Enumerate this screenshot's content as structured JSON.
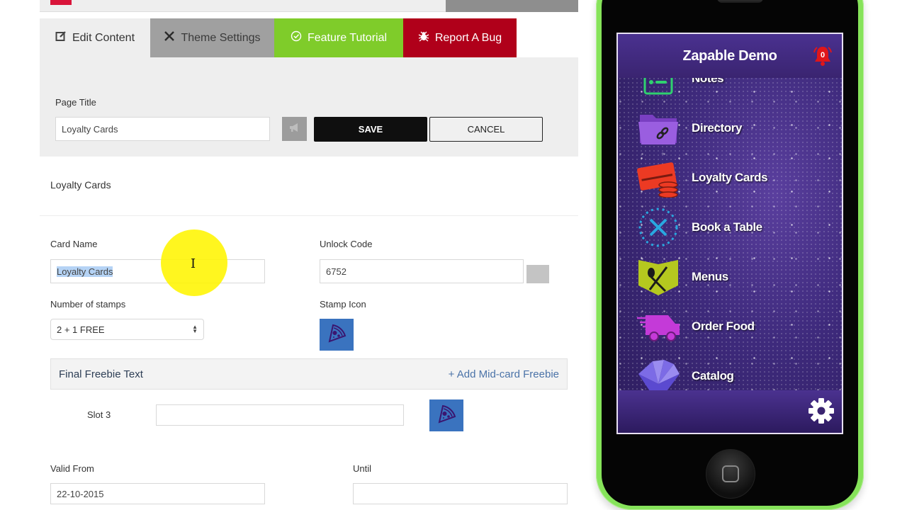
{
  "tabs": [
    {
      "label": "Edit Content",
      "icon": "edit-icon"
    },
    {
      "label": "Theme Settings",
      "icon": "close-x-icon"
    },
    {
      "label": "Feature Tutorial",
      "icon": "check-circle-icon"
    },
    {
      "label": "Report A Bug",
      "icon": "bug-icon"
    }
  ],
  "page_title": {
    "label": "Page Title",
    "value": "Loyalty Cards",
    "save_label": "SAVE",
    "cancel_label": "CANCEL"
  },
  "section_heading": "Loyalty Cards",
  "form": {
    "card_name_label": "Card Name",
    "card_name_value": "Loyalty Cards",
    "unlock_code_label": "Unlock Code",
    "unlock_code_value": "6752",
    "stamps_label": "Number of stamps",
    "stamps_value": "2 + 1 FREE",
    "stamp_icon_label": "Stamp Icon",
    "freebie_title": "Final Freebie Text",
    "add_midcard_label": "+ Add Mid-card Freebie",
    "slot_label": "Slot 3",
    "slot_value": "",
    "valid_from_label": "Valid From",
    "valid_from_value": "22-10-2015",
    "until_label": "Until",
    "until_value": ""
  },
  "colors": {
    "tutorial_green": "#7fcc2a",
    "bug_red": "#b0001a",
    "stamp_blue": "#3a73bf",
    "phone_green": "#86e35a"
  },
  "phone": {
    "app_title": "Zapable Demo",
    "notification_count": "0",
    "menu": [
      {
        "label": "Notes",
        "icon": "notes-icon"
      },
      {
        "label": "Directory",
        "icon": "folder-link-icon"
      },
      {
        "label": "Loyalty Cards",
        "icon": "loyalty-card-icon"
      },
      {
        "label": "Book a Table",
        "icon": "clock-cutlery-icon"
      },
      {
        "label": "Menus",
        "icon": "menu-cutlery-icon"
      },
      {
        "label": "Order Food",
        "icon": "delivery-truck-icon"
      },
      {
        "label": "Catalog",
        "icon": "catalog-fan-icon"
      }
    ]
  }
}
